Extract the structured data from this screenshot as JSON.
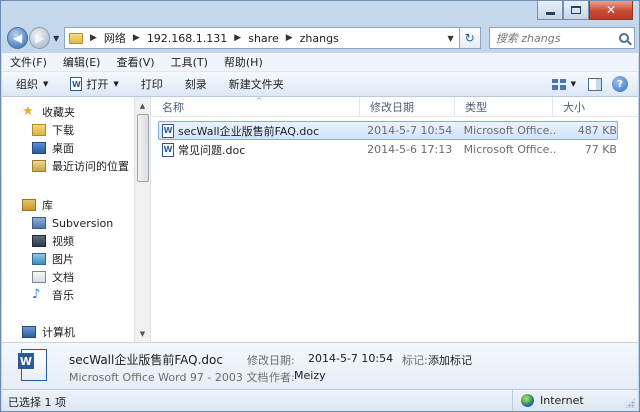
{
  "window": {
    "caption_buttons": {
      "minimize": "—",
      "maximize": "□",
      "close": "✕"
    }
  },
  "navigation": {
    "back_glyph": "◀",
    "forward_glyph": "▶",
    "dropdown_glyph": "▼"
  },
  "address": {
    "crumbs": [
      "网络",
      "192.168.1.131",
      "share",
      "zhangs"
    ],
    "separator": "▶",
    "refresh_glyph": "↻"
  },
  "search": {
    "placeholder": "搜索 zhangs"
  },
  "menubar": {
    "items": [
      "文件(F)",
      "编辑(E)",
      "查看(V)",
      "工具(T)",
      "帮助(H)"
    ]
  },
  "toolbar": {
    "organize": "组织",
    "open": "打开",
    "print": "打印",
    "burn": "刻录",
    "new_folder": "新建文件夹",
    "dropdown_glyph": "▼",
    "help_glyph": "?"
  },
  "navpane": {
    "favorites": {
      "title": "收藏夹",
      "items": [
        "下载",
        "桌面",
        "最近访问的位置"
      ]
    },
    "libraries": {
      "title": "库",
      "items": [
        "Subversion",
        "视频",
        "图片",
        "文档",
        "音乐"
      ]
    },
    "computer": {
      "title": "计算机"
    }
  },
  "file_list": {
    "columns": {
      "name": "名称",
      "date": "修改日期",
      "type": "类型",
      "size": "大小"
    },
    "sort_caret": "^",
    "rows": [
      {
        "name": "secWall企业版售前FAQ.doc",
        "date": "2014-5-7 10:54",
        "type": "Microsoft Office...",
        "size": "487 KB",
        "selected": true
      },
      {
        "name": "常见问题.doc",
        "date": "2014-5-6 17:13",
        "type": "Microsoft Office...",
        "size": "77 KB",
        "selected": false
      }
    ]
  },
  "details": {
    "file_name": "secWall企业版售前FAQ.doc",
    "file_type": "Microsoft Office Word 97 - 2003 文档",
    "modified_label": "修改日期:",
    "modified_value": "2014-5-7 10:54",
    "tags_label": "标记:",
    "tags_value": "添加标记",
    "author_label": "作者:",
    "author_value": "Meizy"
  },
  "statusbar": {
    "selection": "已选择 1 项",
    "zone": "Internet"
  },
  "colors": {
    "frame": "#b6cde6",
    "selection": "#cfe3fa",
    "selection_border": "#84acdd",
    "close_button": "#c94a35"
  }
}
